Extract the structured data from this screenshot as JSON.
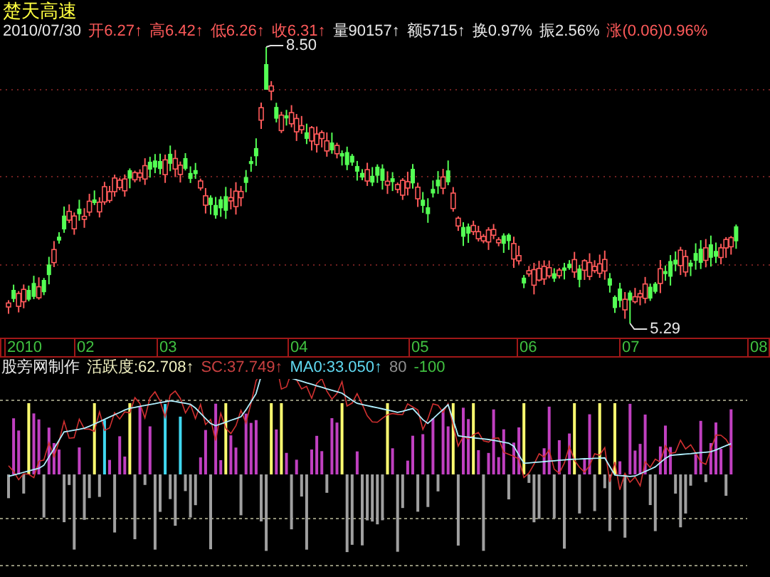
{
  "stock_name": "楚天高速",
  "quote": {
    "date": "2010/07/30",
    "fields": [
      {
        "text": "开6.27",
        "arrow": "↑",
        "color": "#ff5a5a"
      },
      {
        "text": "高6.42",
        "arrow": "↑",
        "color": "#ff5a5a"
      },
      {
        "text": "低6.26",
        "arrow": "↑",
        "color": "#ff5a5a"
      },
      {
        "text": "收6.31",
        "arrow": "↑",
        "color": "#ff5a5a"
      },
      {
        "text": "量90157",
        "arrow": "↑",
        "color": "#e8e8e8"
      },
      {
        "text": "额5715",
        "arrow": "↑",
        "color": "#e8e8e8"
      },
      {
        "text": "换0.97%",
        "color": "#e8e8e8"
      },
      {
        "text": "振2.56%",
        "color": "#e8e8e8"
      },
      {
        "text": "涨(0.06)0.96%",
        "color": "#ff5a5a"
      }
    ]
  },
  "price_chart": {
    "high_marker": "8.50",
    "low_marker": "5.29"
  },
  "time_axis": [
    "2010",
    "02",
    "03",
    "04",
    "05",
    "06",
    "07",
    "08"
  ],
  "indicator": {
    "source": "股旁网制作",
    "fields": [
      {
        "text": "活跃度:62.708",
        "arrow": "↑",
        "color": "#f0f0c0"
      },
      {
        "text": "SC:37.749",
        "arrow": "↑",
        "color": "#c84040"
      },
      {
        "text": "MA0:33.050",
        "arrow": "↑",
        "color": "#60d8f0"
      },
      {
        "text": "80",
        "color": "#909090"
      },
      {
        "text": "-100",
        "color": "#40c040"
      }
    ]
  }
}
